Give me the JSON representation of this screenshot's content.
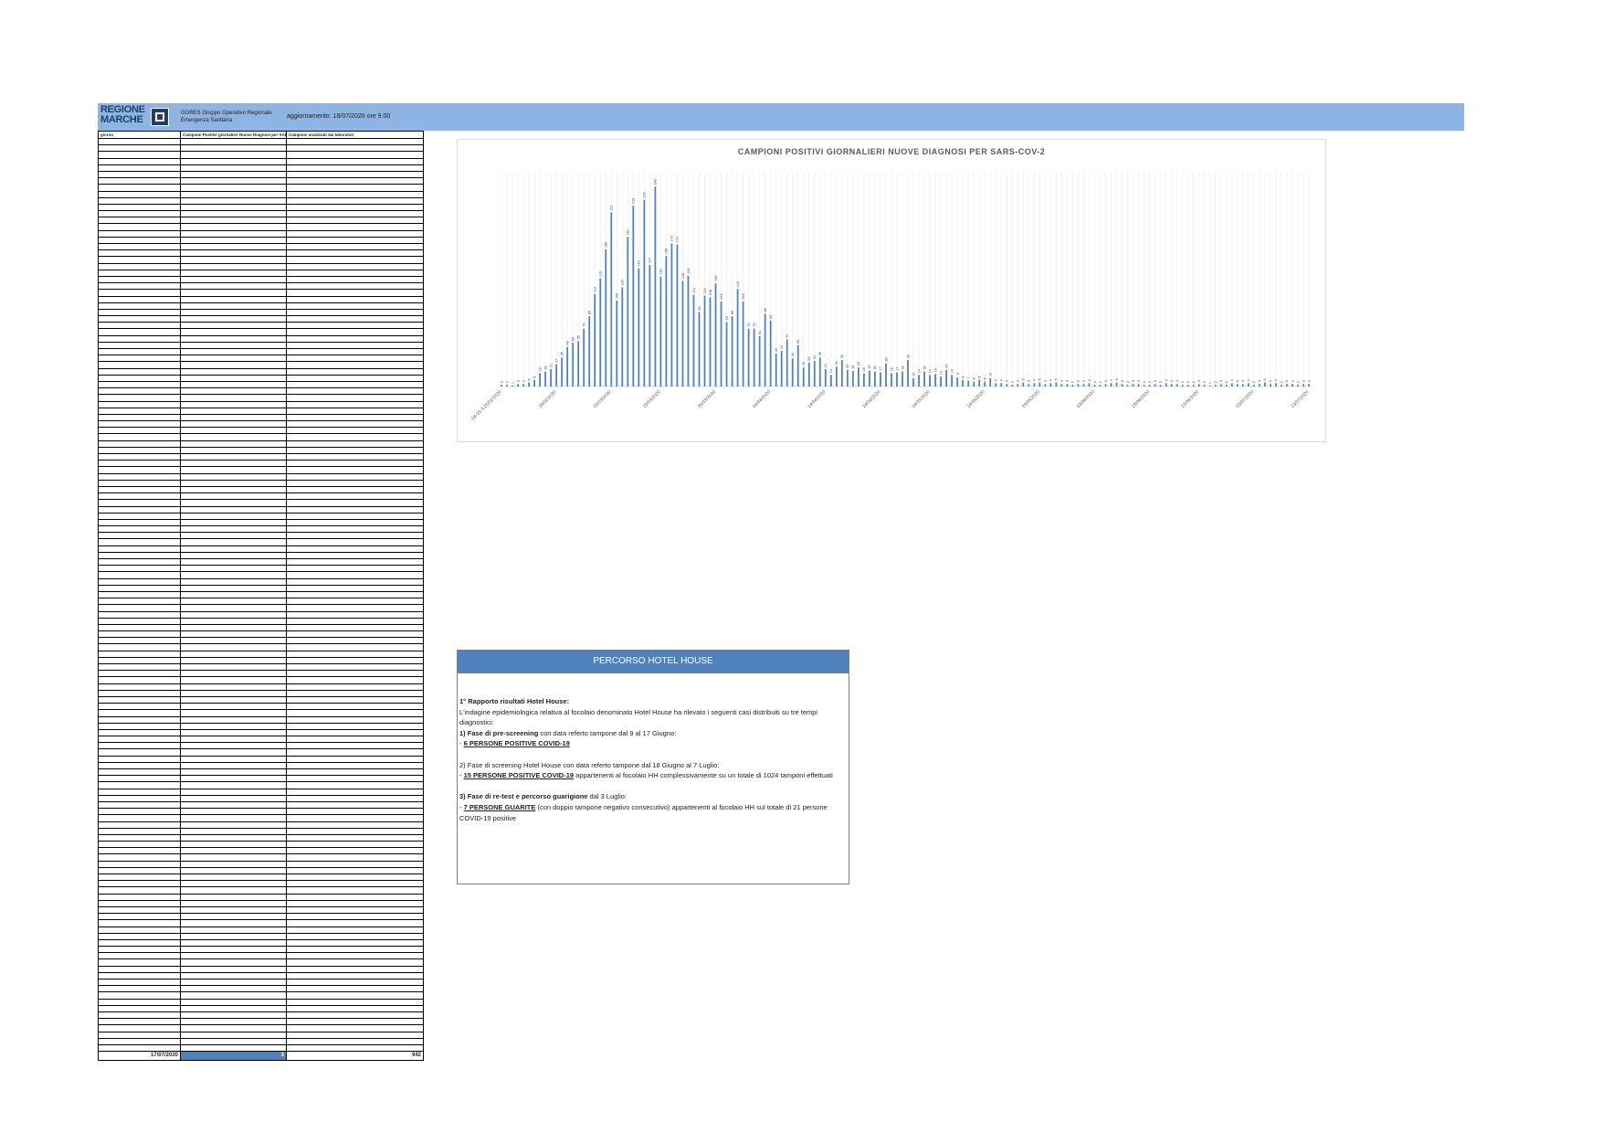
{
  "header": {
    "logo_line1": "REGIONE",
    "logo_line2": "MARCHE",
    "org_line1": "GORES Gruppo Operativo Regionale",
    "org_line2": "Emergenza Sanitaria",
    "update": "aggiornamento: 18/07/2020 ore 9.00"
  },
  "table": {
    "headers": [
      "giorno",
      "Campioni Positivi giornalieri Nuove Diagnosi per SARS-COV-2",
      "Campioni analizzati dai laboratori"
    ],
    "total": {
      "date": "17/07/2020",
      "positivi": "3",
      "analizzati": "942"
    }
  },
  "chart_data": {
    "type": "bar",
    "title": "CAMPIONI POSITIVI GIORNALIERI NUOVE DIAGNOSI PER SARS-COV-2",
    "color": "#4f81bd",
    "categories_label_sample": [
      "04-05-3 25/02/2020",
      "29/02/2020",
      "05/03/2020",
      "15/03/2020",
      "25/03/2020",
      "04/04/2020",
      "14/04/2020",
      "24/04/2020",
      "04/05/2020",
      "14/05/2020",
      "24/05/2020",
      "03/06/2020",
      "13/06/2020",
      "23/06/2020",
      "03/07/2020",
      "13/07/2020"
    ],
    "values": [
      2,
      2,
      1,
      3,
      3,
      5,
      8,
      16,
      18,
      21,
      27,
      35,
      48,
      53,
      55,
      70,
      85,
      112,
      131,
      166,
      211,
      104,
      120,
      181,
      219,
      143,
      226,
      147,
      242,
      133,
      158,
      173,
      172,
      128,
      134,
      111,
      90,
      110,
      108,
      125,
      103,
      78,
      85,
      118,
      103,
      70,
      70,
      61,
      88,
      80,
      40,
      43,
      57,
      34,
      50,
      23,
      29,
      31,
      35,
      21,
      14,
      24,
      32,
      20,
      19,
      23,
      16,
      19,
      18,
      17,
      28,
      16,
      17,
      18,
      32,
      10,
      14,
      18,
      14,
      15,
      12,
      20,
      14,
      11,
      8,
      7,
      6,
      8,
      6,
      10,
      4,
      4,
      3,
      2,
      3,
      5,
      3,
      4,
      5,
      3,
      4,
      5,
      3,
      3,
      2,
      3,
      3,
      4,
      2,
      2,
      3,
      4,
      5,
      3,
      2,
      3,
      3,
      2,
      2,
      3,
      2,
      4,
      3,
      3,
      2,
      2,
      2,
      3,
      2,
      1,
      2,
      3,
      2,
      4,
      3,
      3,
      4,
      2,
      3,
      5,
      3,
      4,
      2,
      3,
      3,
      2,
      3,
      3
    ],
    "ylim": [
      0,
      260
    ]
  },
  "hotel_house": {
    "title": "PERCORSO HOTEL HOUSE",
    "heading": "1° Rapporto  risultati Hotel House:",
    "intro": "L'indagine epidemiologica relativa al focolaio denominato Hotel House ha rilevato i seguenti casi distribuiti su tre tempi diagnostici:",
    "phase1_title": "1) Fase di pre-screening",
    "phase1_rest": " con data referto tampone dal 9 al 17 Giugno:",
    "phase1_result": "6 PERSONE POSITIVE COVID-19",
    "phase2_title": "2) Fase di screening Hotel House con data referto tampone dal 18 Giugno al 7 Luglio:",
    "phase2_result": "15 PERSONE POSITIVE COVID-19",
    "phase2_rest": " appartenenti al focolaio HH complessivamente su un totale di 1024 tamponi effettuati",
    "phase3_title": "3) Fase di re-test e percorso guarigione",
    "phase3_rest": " dal 3 Luglio:",
    "phase3_result": "7 PERSONE GUARITE",
    "phase3_tail": " (con doppio tampone negativo consecutivo) appartenenti al focolaio HH sul totale di 21 persone COVID-19 positive"
  }
}
